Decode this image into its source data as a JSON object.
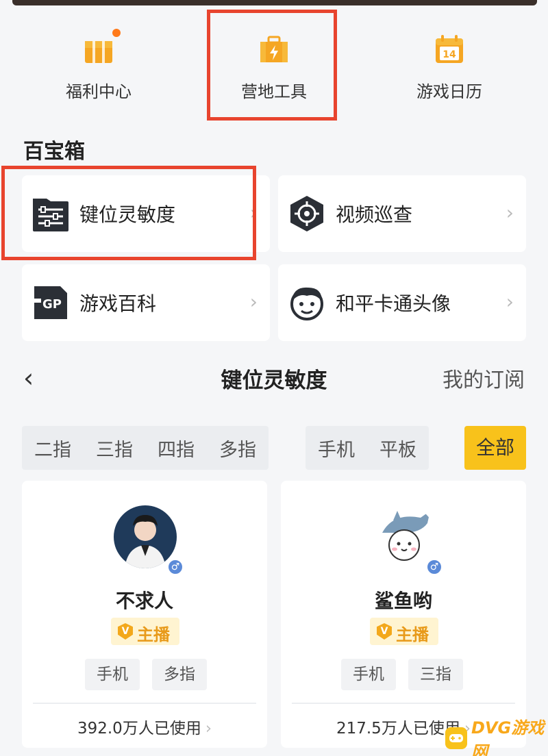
{
  "quick_links": [
    {
      "label": "福利中心",
      "icon": "gift-box-icon"
    },
    {
      "label": "营地工具",
      "icon": "toolbox-icon"
    },
    {
      "label": "游戏日历",
      "icon": "calendar-icon",
      "day": "14"
    }
  ],
  "toolbox": {
    "title": "百宝箱",
    "items": [
      {
        "label": "键位灵敏度",
        "icon": "sliders-icon"
      },
      {
        "label": "视频巡查",
        "icon": "crosshair-icon"
      },
      {
        "label": "游戏百科",
        "icon": "gp-wiki-icon",
        "icon_text": "GP"
      },
      {
        "label": "和平卡通头像",
        "icon": "cartoon-face-icon"
      }
    ],
    "chevron": "›"
  },
  "subnav": {
    "back": "‹",
    "title": "键位灵敏度",
    "right": "我的订阅"
  },
  "filters": {
    "fingers": [
      "二指",
      "三指",
      "四指",
      "多指"
    ],
    "devices": [
      "手机",
      "平板"
    ],
    "all": "全部"
  },
  "users": [
    {
      "name": "不求人",
      "gender": "♂",
      "badge": "主播",
      "badge_mark": "V",
      "tags": [
        "手机",
        "多指"
      ],
      "usage": "392.0万人已使用",
      "chevron": "›"
    },
    {
      "name": "鲨鱼哟",
      "gender": "♂",
      "badge": "主播",
      "badge_mark": "V",
      "tags": [
        "手机",
        "三指"
      ],
      "usage": "217.5万人已使用",
      "chevron": "›"
    }
  ],
  "watermark": {
    "text": "DVG游戏网"
  },
  "colors": {
    "accent": "#f8c21b",
    "highlight_box": "#e8442e",
    "icon_orange": "#f5a623"
  }
}
